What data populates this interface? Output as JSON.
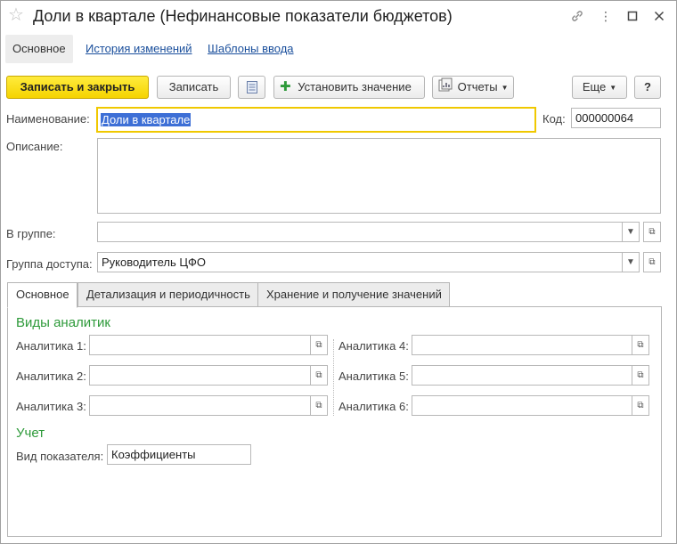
{
  "window": {
    "title": "Доли в квартале (Нефинансовые показатели бюджетов)",
    "icons": [
      "star-icon",
      "link-icon",
      "more-vertical-icon",
      "maximize-icon",
      "close-icon"
    ]
  },
  "nav": {
    "main": "Основное",
    "history": "История изменений",
    "templates": "Шаблоны ввода"
  },
  "toolbar": {
    "save_close": "Записать и закрыть",
    "save": "Записать",
    "set_value": "Установить значение",
    "reports": "Отчеты",
    "more": "Еще",
    "help": "?"
  },
  "form": {
    "name_label": "Наименование:",
    "name_value": "Доли в квартале",
    "code_label": "Код:",
    "code_value": "000000064",
    "description_label": "Описание:",
    "description_value": "",
    "group_label": "В группе:",
    "group_value": "",
    "access_label": "Группа доступа:",
    "access_value": "Руководитель ЦФО"
  },
  "tabs": [
    {
      "label": "Основное",
      "active": true
    },
    {
      "label": "Детализация и периодичность",
      "active": false
    },
    {
      "label": "Хранение и получение значений",
      "active": false
    }
  ],
  "panel": {
    "analytics_title": "Виды аналитик",
    "analytics": [
      {
        "label": "Аналитика 1:",
        "value": ""
      },
      {
        "label": "Аналитика 2:",
        "value": ""
      },
      {
        "label": "Аналитика 3:",
        "value": ""
      },
      {
        "label": "Аналитика 4:",
        "value": ""
      },
      {
        "label": "Аналитика 5:",
        "value": ""
      },
      {
        "label": "Аналитика 6:",
        "value": ""
      }
    ],
    "accounting_title": "Учет",
    "indicator_label": "Вид показателя:",
    "indicator_value": "Коэффициенты"
  },
  "colors": {
    "accent_yellow": "#f5d300",
    "section_green": "#2e9a3a",
    "link_blue": "#1a4f9c",
    "selection_blue": "#3d6fd6"
  }
}
